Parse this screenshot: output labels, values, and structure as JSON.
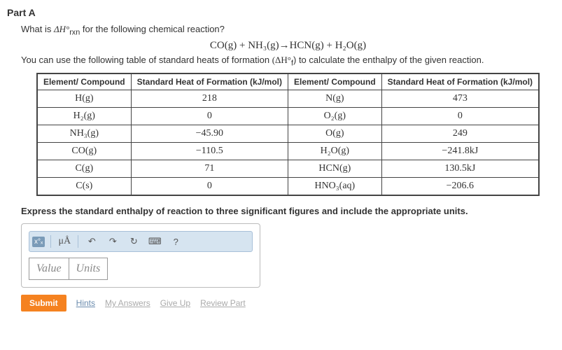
{
  "part_label": "Part A",
  "question_pre": "What is ",
  "question_var": "ΔH°",
  "question_sub": "rxn",
  "question_post": " for the following chemical reaction?",
  "equation": "CO(g) + NH₃(g)→HCN(g) + H₂O(g)",
  "subtext_pre": "You can use the following table of standard heats of formation ",
  "subtext_var": "(ΔH°",
  "subtext_sub": "f",
  "subtext_post": ") to calculate the enthalpy of the given reaction.",
  "headers": {
    "col1": "Element/ Compound",
    "col2": "Standard Heat of Formation (kJ/mol)",
    "col3": "Element/ Compound",
    "col4": "Standard Heat of Formation (kJ/mol)"
  },
  "rows": [
    {
      "c1": "H(g)",
      "c2": "218",
      "c3": "N(g)",
      "c4": "473"
    },
    {
      "c1": "H₂(g)",
      "c2": "0",
      "c3": "O₂(g)",
      "c4": "0"
    },
    {
      "c1": "NH₃(g)",
      "c2": "−45.90",
      "c3": "O(g)",
      "c4": "249"
    },
    {
      "c1": "CO(g)",
      "c2": "−110.5",
      "c3": "H₂O(g)",
      "c4": "−241.8kJ"
    },
    {
      "c1": "C(g)",
      "c2": "71",
      "c3": "HCN(g)",
      "c4": "130.5kJ"
    },
    {
      "c1": "C(s)",
      "c2": "0",
      "c3": "HNO₃(aq)",
      "c4": "−206.6"
    }
  ],
  "instruction": "Express the standard enthalpy of reaction to three significant figures and include the appropriate units.",
  "toolbar": {
    "mua": "μÅ",
    "undo": "↶",
    "redo": "↷",
    "reset": "↻",
    "kb": "⌨",
    "help": "?"
  },
  "inputs": {
    "value": "Value",
    "units": "Units"
  },
  "footer": {
    "submit": "Submit",
    "hints": "Hints",
    "myanswers": "My Answers",
    "giveup": "Give Up",
    "review": "Review Part"
  },
  "chart_data": {
    "type": "table",
    "title": "Standard Heats of Formation",
    "columns": [
      "Element/Compound",
      "ΔH°f (kJ/mol)"
    ],
    "data": [
      {
        "species": "H(g)",
        "dHf": 218
      },
      {
        "species": "H2(g)",
        "dHf": 0
      },
      {
        "species": "NH3(g)",
        "dHf": -45.9
      },
      {
        "species": "CO(g)",
        "dHf": -110.5
      },
      {
        "species": "C(g)",
        "dHf": 71
      },
      {
        "species": "C(s)",
        "dHf": 0
      },
      {
        "species": "N(g)",
        "dHf": 473
      },
      {
        "species": "O2(g)",
        "dHf": 0
      },
      {
        "species": "O(g)",
        "dHf": 249
      },
      {
        "species": "H2O(g)",
        "dHf": -241.8
      },
      {
        "species": "HCN(g)",
        "dHf": 130.5
      },
      {
        "species": "HNO3(aq)",
        "dHf": -206.6
      }
    ]
  }
}
